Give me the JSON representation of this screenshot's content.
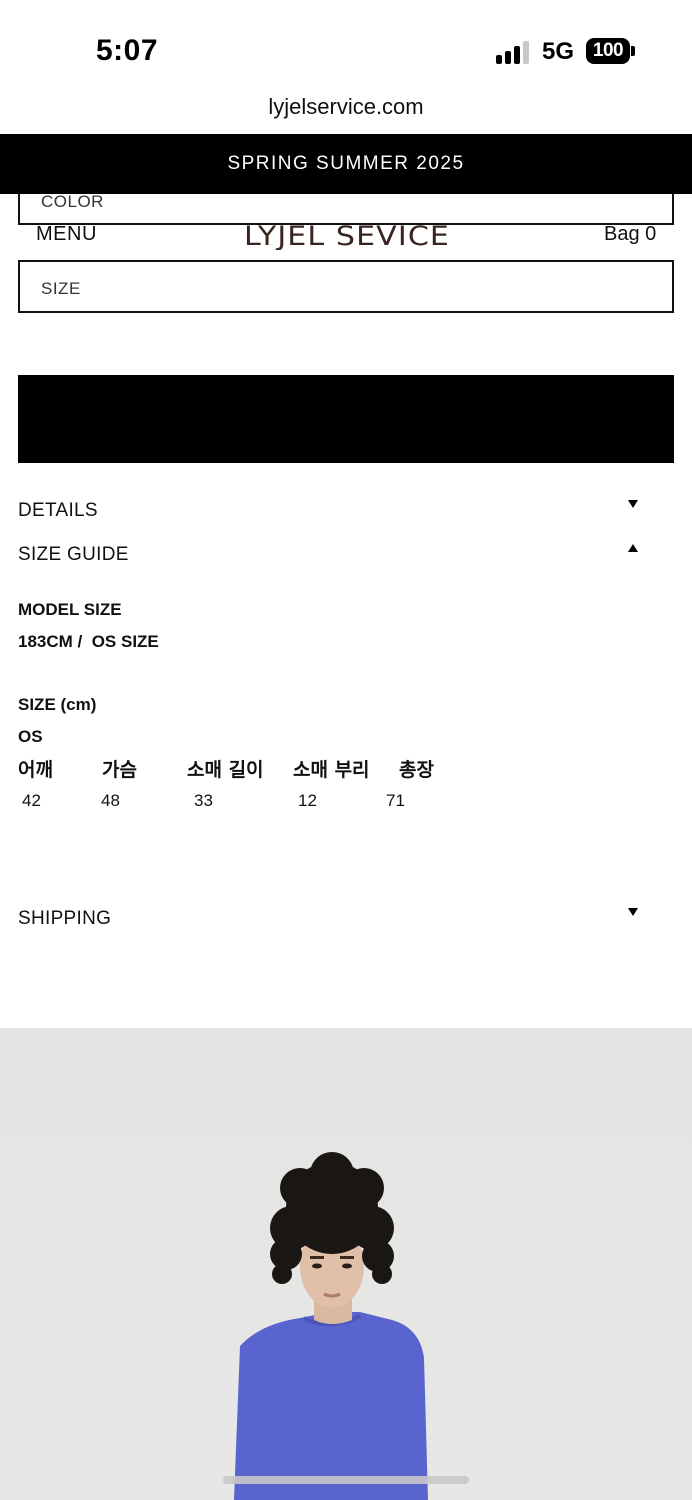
{
  "status_bar": {
    "time": "5:07",
    "network": "5G",
    "battery": "100"
  },
  "browser": {
    "url": "lyjelservice.com"
  },
  "promo_banner": {
    "text": "SPRING SUMMER 2025"
  },
  "header": {
    "menu_label": "MENU",
    "logo_text": "LYJEL SEVICE",
    "bag_label": "Bag 0"
  },
  "product_options": {
    "color_label": "COLOR",
    "size_label": "SIZE"
  },
  "accordion": {
    "details_label": "DETAILS",
    "size_guide_label": "SIZE GUIDE",
    "shipping_label": "SHIPPING"
  },
  "size_guide": {
    "model_heading": "MODEL SIZE",
    "model_value": "183CM /  OS SIZE",
    "size_heading": "SIZE (cm)",
    "size_name": "OS",
    "columns": [
      "어깨",
      "가슴",
      "소매 길이",
      "소매 부리",
      "총장"
    ],
    "values": [
      "42",
      "48",
      "33",
      "12",
      "71"
    ]
  },
  "colors": {
    "background": "#ffffff",
    "banner": "#000000",
    "cta": "#000000",
    "logo": "#3a2420",
    "shirt": "#5964cf",
    "photo_bg": "#e5e5e4"
  }
}
